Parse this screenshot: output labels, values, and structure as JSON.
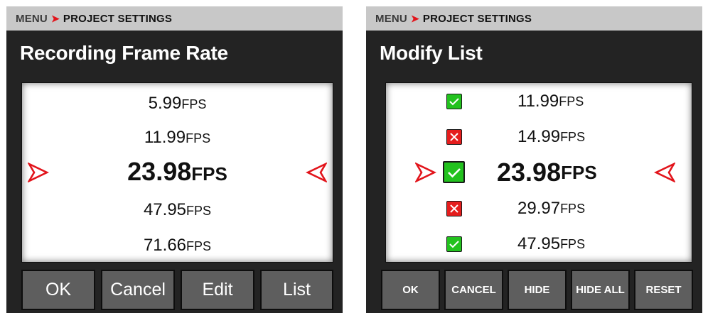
{
  "colors": {
    "accent_red": "#e2141b",
    "panel_bg": "#232323",
    "breadcrumb_bg": "#c8c8c8",
    "button_bg": "#5e5e5e",
    "check_green": "#22c21e",
    "cross_red": "#e51d1d"
  },
  "left_screen": {
    "breadcrumb": {
      "menu": "MENU",
      "current": "PROJECT SETTINGS"
    },
    "title": "Recording Frame Rate",
    "items": [
      {
        "value": "5.99",
        "unit": "FPS"
      },
      {
        "value": "11.99",
        "unit": "FPS"
      },
      {
        "value": "23.98",
        "unit": "FPS",
        "selected": true
      },
      {
        "value": "47.95",
        "unit": "FPS"
      },
      {
        "value": "71.66",
        "unit": "FPS"
      }
    ],
    "buttons": {
      "ok": "OK",
      "cancel": "Cancel",
      "edit": "Edit",
      "list": "List"
    }
  },
  "right_screen": {
    "breadcrumb": {
      "menu": "MENU",
      "current": "PROJECT SETTINGS"
    },
    "title": "Modify List",
    "items": [
      {
        "value": "11.99",
        "unit": "FPS",
        "enabled": true
      },
      {
        "value": "14.99",
        "unit": "FPS",
        "enabled": false
      },
      {
        "value": "23.98",
        "unit": "FPS",
        "enabled": true,
        "selected": true
      },
      {
        "value": "29.97",
        "unit": "FPS",
        "enabled": false
      },
      {
        "value": "47.95",
        "unit": "FPS",
        "enabled": true
      }
    ],
    "buttons": {
      "ok": "OK",
      "cancel": "CANCEL",
      "hide": "HIDE",
      "hide_all": "HIDE ALL",
      "reset": "RESET"
    }
  }
}
